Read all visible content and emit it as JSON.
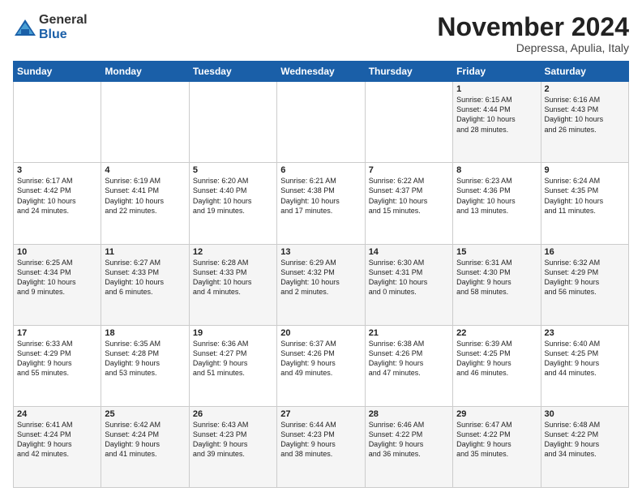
{
  "logo": {
    "general": "General",
    "blue": "Blue"
  },
  "title": "November 2024",
  "subtitle": "Depressa, Apulia, Italy",
  "days_header": [
    "Sunday",
    "Monday",
    "Tuesday",
    "Wednesday",
    "Thursday",
    "Friday",
    "Saturday"
  ],
  "weeks": [
    [
      {
        "day": "",
        "info": ""
      },
      {
        "day": "",
        "info": ""
      },
      {
        "day": "",
        "info": ""
      },
      {
        "day": "",
        "info": ""
      },
      {
        "day": "",
        "info": ""
      },
      {
        "day": "1",
        "info": "Sunrise: 6:15 AM\nSunset: 4:44 PM\nDaylight: 10 hours\nand 28 minutes."
      },
      {
        "day": "2",
        "info": "Sunrise: 6:16 AM\nSunset: 4:43 PM\nDaylight: 10 hours\nand 26 minutes."
      }
    ],
    [
      {
        "day": "3",
        "info": "Sunrise: 6:17 AM\nSunset: 4:42 PM\nDaylight: 10 hours\nand 24 minutes."
      },
      {
        "day": "4",
        "info": "Sunrise: 6:19 AM\nSunset: 4:41 PM\nDaylight: 10 hours\nand 22 minutes."
      },
      {
        "day": "5",
        "info": "Sunrise: 6:20 AM\nSunset: 4:40 PM\nDaylight: 10 hours\nand 19 minutes."
      },
      {
        "day": "6",
        "info": "Sunrise: 6:21 AM\nSunset: 4:38 PM\nDaylight: 10 hours\nand 17 minutes."
      },
      {
        "day": "7",
        "info": "Sunrise: 6:22 AM\nSunset: 4:37 PM\nDaylight: 10 hours\nand 15 minutes."
      },
      {
        "day": "8",
        "info": "Sunrise: 6:23 AM\nSunset: 4:36 PM\nDaylight: 10 hours\nand 13 minutes."
      },
      {
        "day": "9",
        "info": "Sunrise: 6:24 AM\nSunset: 4:35 PM\nDaylight: 10 hours\nand 11 minutes."
      }
    ],
    [
      {
        "day": "10",
        "info": "Sunrise: 6:25 AM\nSunset: 4:34 PM\nDaylight: 10 hours\nand 9 minutes."
      },
      {
        "day": "11",
        "info": "Sunrise: 6:27 AM\nSunset: 4:33 PM\nDaylight: 10 hours\nand 6 minutes."
      },
      {
        "day": "12",
        "info": "Sunrise: 6:28 AM\nSunset: 4:33 PM\nDaylight: 10 hours\nand 4 minutes."
      },
      {
        "day": "13",
        "info": "Sunrise: 6:29 AM\nSunset: 4:32 PM\nDaylight: 10 hours\nand 2 minutes."
      },
      {
        "day": "14",
        "info": "Sunrise: 6:30 AM\nSunset: 4:31 PM\nDaylight: 10 hours\nand 0 minutes."
      },
      {
        "day": "15",
        "info": "Sunrise: 6:31 AM\nSunset: 4:30 PM\nDaylight: 9 hours\nand 58 minutes."
      },
      {
        "day": "16",
        "info": "Sunrise: 6:32 AM\nSunset: 4:29 PM\nDaylight: 9 hours\nand 56 minutes."
      }
    ],
    [
      {
        "day": "17",
        "info": "Sunrise: 6:33 AM\nSunset: 4:29 PM\nDaylight: 9 hours\nand 55 minutes."
      },
      {
        "day": "18",
        "info": "Sunrise: 6:35 AM\nSunset: 4:28 PM\nDaylight: 9 hours\nand 53 minutes."
      },
      {
        "day": "19",
        "info": "Sunrise: 6:36 AM\nSunset: 4:27 PM\nDaylight: 9 hours\nand 51 minutes."
      },
      {
        "day": "20",
        "info": "Sunrise: 6:37 AM\nSunset: 4:26 PM\nDaylight: 9 hours\nand 49 minutes."
      },
      {
        "day": "21",
        "info": "Sunrise: 6:38 AM\nSunset: 4:26 PM\nDaylight: 9 hours\nand 47 minutes."
      },
      {
        "day": "22",
        "info": "Sunrise: 6:39 AM\nSunset: 4:25 PM\nDaylight: 9 hours\nand 46 minutes."
      },
      {
        "day": "23",
        "info": "Sunrise: 6:40 AM\nSunset: 4:25 PM\nDaylight: 9 hours\nand 44 minutes."
      }
    ],
    [
      {
        "day": "24",
        "info": "Sunrise: 6:41 AM\nSunset: 4:24 PM\nDaylight: 9 hours\nand 42 minutes."
      },
      {
        "day": "25",
        "info": "Sunrise: 6:42 AM\nSunset: 4:24 PM\nDaylight: 9 hours\nand 41 minutes."
      },
      {
        "day": "26",
        "info": "Sunrise: 6:43 AM\nSunset: 4:23 PM\nDaylight: 9 hours\nand 39 minutes."
      },
      {
        "day": "27",
        "info": "Sunrise: 6:44 AM\nSunset: 4:23 PM\nDaylight: 9 hours\nand 38 minutes."
      },
      {
        "day": "28",
        "info": "Sunrise: 6:46 AM\nSunset: 4:22 PM\nDaylight: 9 hours\nand 36 minutes."
      },
      {
        "day": "29",
        "info": "Sunrise: 6:47 AM\nSunset: 4:22 PM\nDaylight: 9 hours\nand 35 minutes."
      },
      {
        "day": "30",
        "info": "Sunrise: 6:48 AM\nSunset: 4:22 PM\nDaylight: 9 hours\nand 34 minutes."
      }
    ]
  ]
}
